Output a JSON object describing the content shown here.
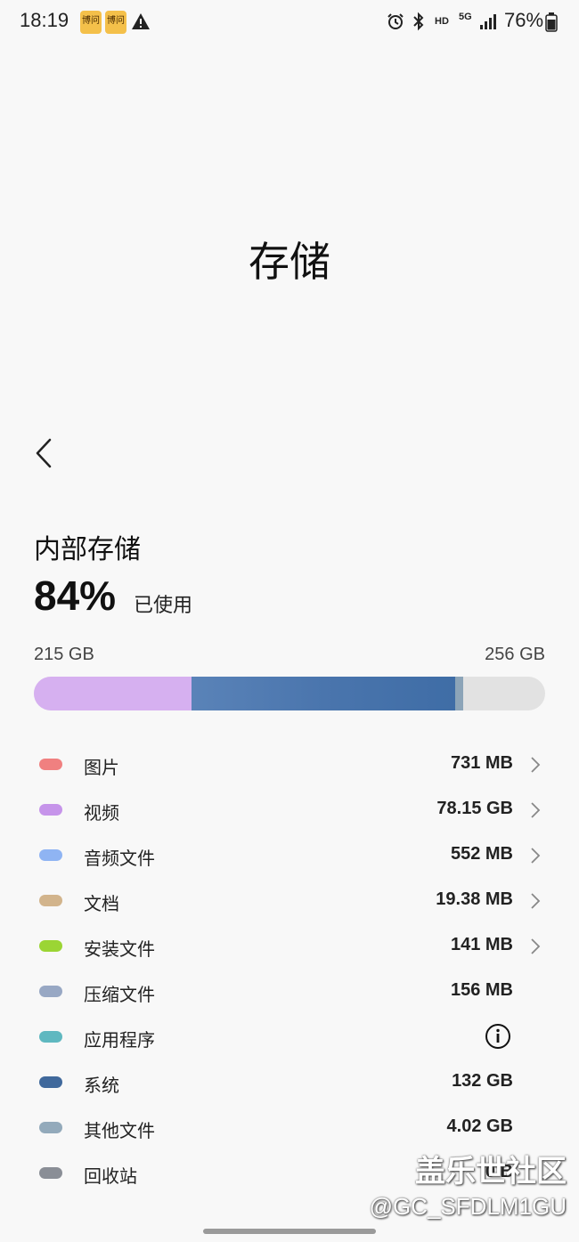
{
  "status": {
    "time": "18:19",
    "app_badges": [
      "博问",
      "博问"
    ],
    "battery": "76%",
    "icons": [
      "alarm-icon",
      "bluetooth-icon",
      "hd-icon",
      "5g-icon",
      "signal-icon",
      "battery-icon"
    ],
    "hd_label": "HD",
    "net_label": "5G"
  },
  "header": {
    "title": "存储"
  },
  "storage": {
    "section_title": "内部存储",
    "percent": "84%",
    "percent_label": "已使用",
    "used": "215 GB",
    "total": "256 GB",
    "usage_fraction": 0.84
  },
  "colors": {
    "bar_track": "#e2e2e2",
    "bar_video": "#d6b0f0",
    "bar_system": "#4a75ad",
    "bar_other": "#8ca4b8"
  },
  "categories": [
    {
      "label": "图片",
      "size": "731 MB",
      "color": "#f08080",
      "chevron": true
    },
    {
      "label": "视频",
      "size": "78.15 GB",
      "color": "#c694ea",
      "chevron": true
    },
    {
      "label": "音频文件",
      "size": "552 MB",
      "color": "#8fb4f3",
      "chevron": true
    },
    {
      "label": "文档",
      "size": "19.38 MB",
      "color": "#d2b48c",
      "chevron": true
    },
    {
      "label": "安装文件",
      "size": "141 MB",
      "color": "#9bd534",
      "chevron": true
    },
    {
      "label": "压缩文件",
      "size": "156 MB",
      "color": "#98a8c4",
      "chevron": false
    },
    {
      "label": "应用程序",
      "size": "",
      "color": "#5fb8c0",
      "chevron": false,
      "info": true
    },
    {
      "label": "系统",
      "size": "132 GB",
      "color": "#40699c",
      "chevron": false
    },
    {
      "label": "其他文件",
      "size": "4.02 GB",
      "color": "#93aabb",
      "chevron": false
    },
    {
      "label": "回收站",
      "size": "0 B",
      "color": "#8a8e96",
      "chevron": false
    }
  ],
  "watermark": {
    "line1": "盖乐世社区",
    "line2": "@GC_SFDLM1GU"
  }
}
